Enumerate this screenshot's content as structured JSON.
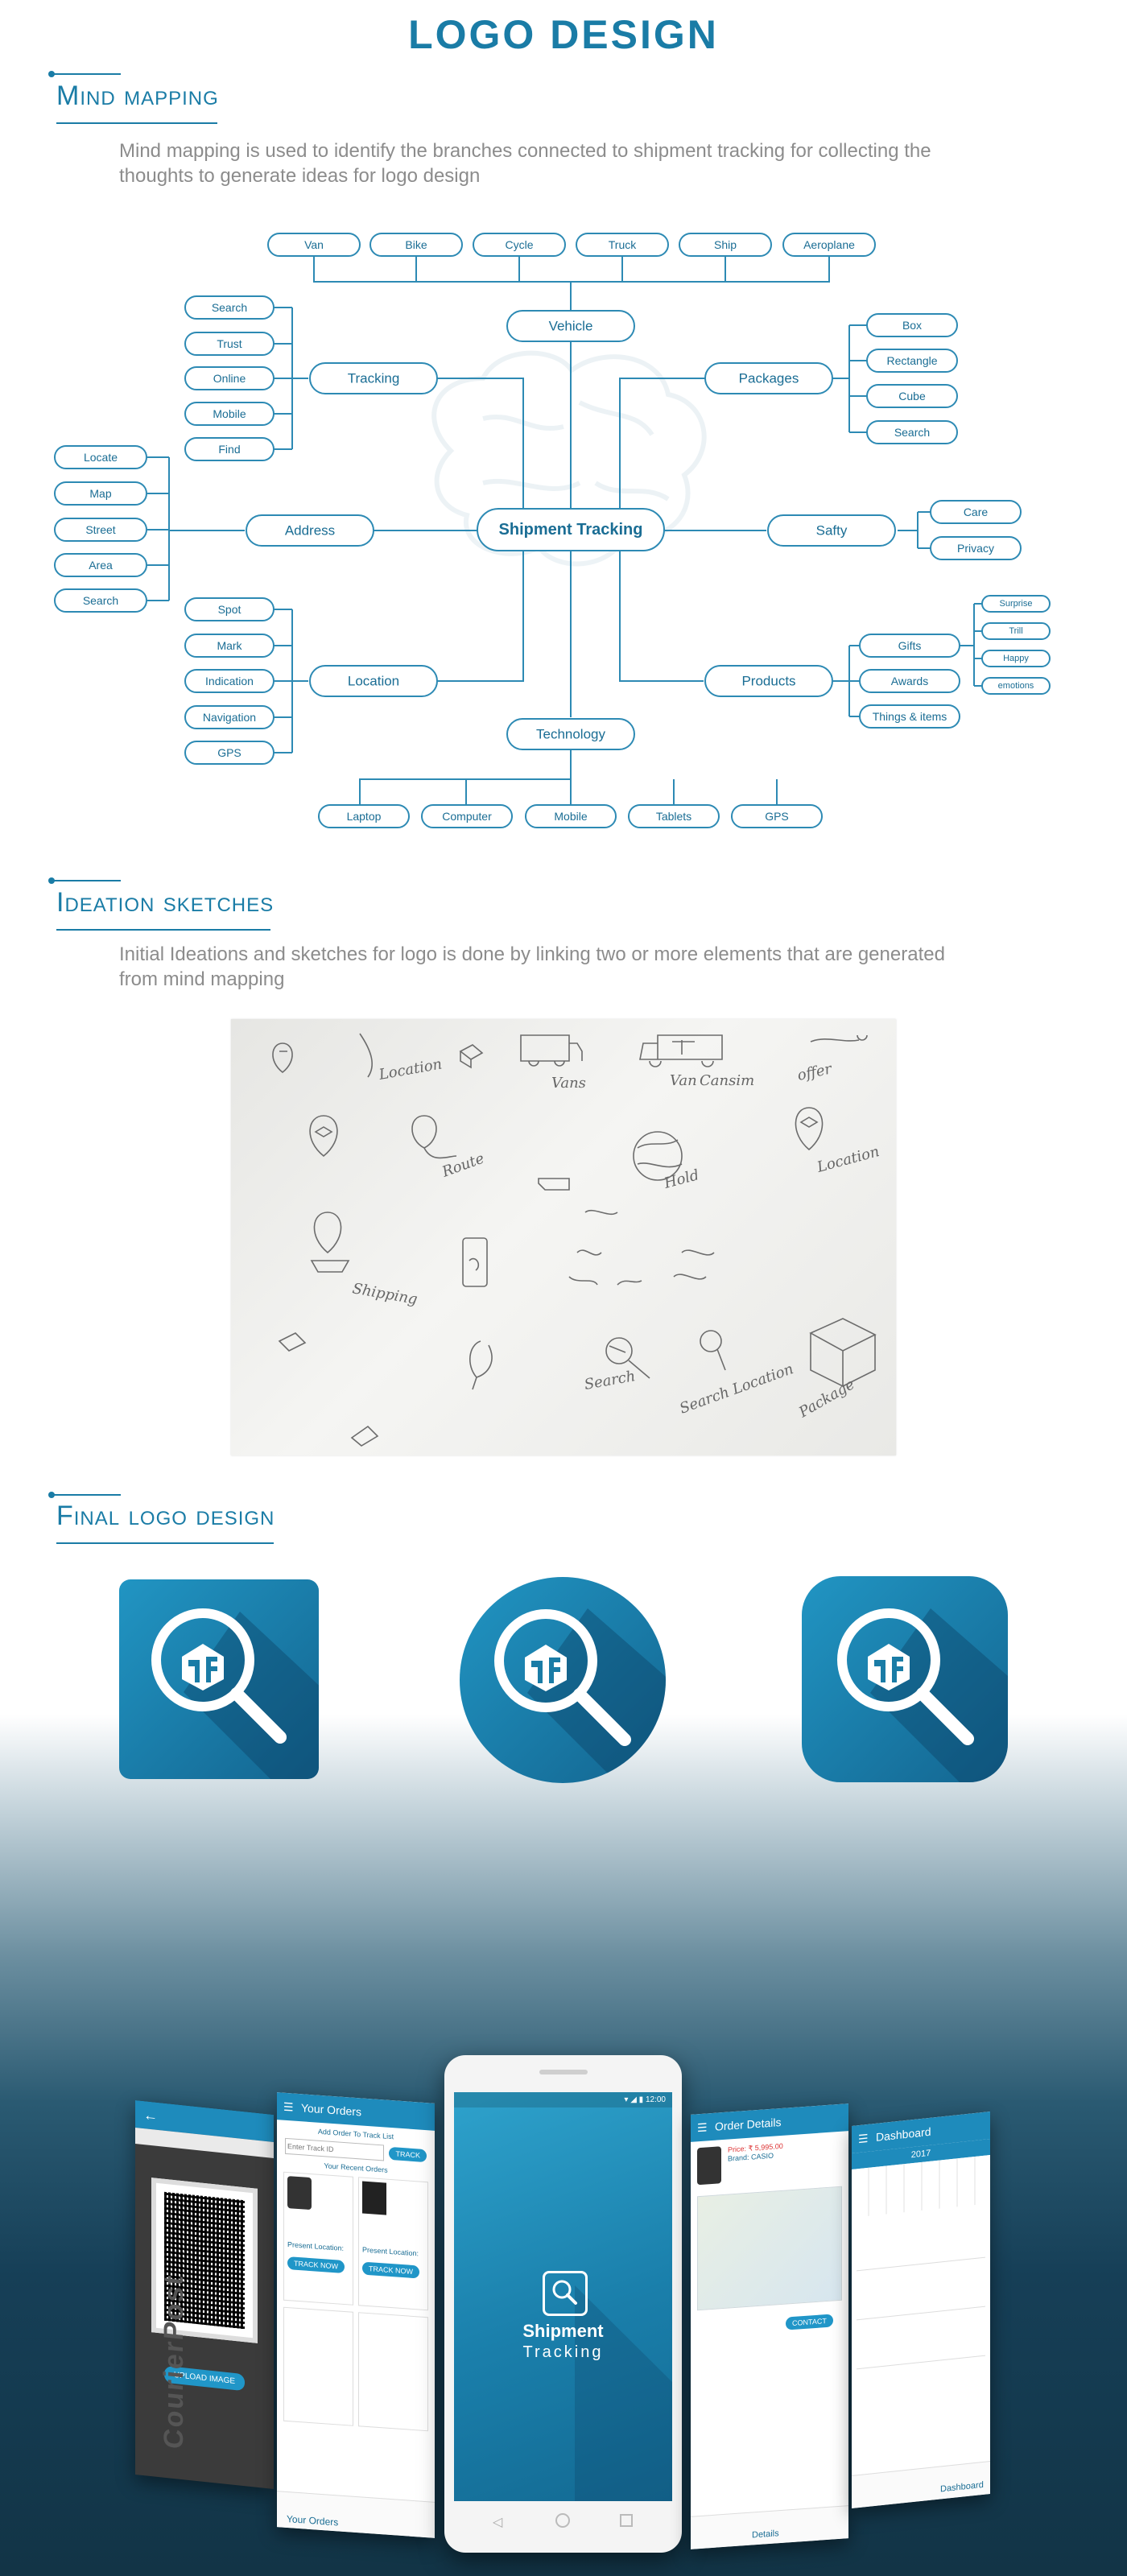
{
  "page_title": "LOGO DESIGN",
  "mind_mapping": {
    "heading": "Mind mapping",
    "description": "Mind mapping is used to identify the branches connected to shipment tracking for collecting the thoughts to generate ideas for logo design",
    "center": "Shipment Tracking",
    "vehicle": {
      "label": "Vehicle",
      "items": [
        "Van",
        "Bike",
        "Cycle",
        "Truck",
        "Ship",
        "Aeroplane"
      ]
    },
    "tracking": {
      "label": "Tracking",
      "items": [
        "Search",
        "Trust",
        "Online",
        "Mobile",
        "Find"
      ]
    },
    "packages": {
      "label": "Packages",
      "items": [
        "Box",
        "Rectangle",
        "Cube",
        "Search"
      ]
    },
    "address": {
      "label": "Address",
      "items": [
        "Locate",
        "Map",
        "Street",
        "Area",
        "Search"
      ]
    },
    "safty": {
      "label": "Safty",
      "items": [
        "Care",
        "Privacy"
      ]
    },
    "location": {
      "label": "Location",
      "items": [
        "Spot",
        "Mark",
        "Indication",
        "Navigation",
        "GPS"
      ]
    },
    "products": {
      "label": "Products",
      "items": [
        "Gifts",
        "Awards",
        "Things & items"
      ],
      "gift_items": [
        "Surprise",
        "Trill",
        "Happy",
        "emotions"
      ]
    },
    "technology": {
      "label": "Technology",
      "items": [
        "Laptop",
        "Computer",
        "Mobile",
        "Tablets",
        "GPS"
      ]
    }
  },
  "ideation": {
    "heading": "Ideation sketches",
    "description": "Initial Ideations and sketches for logo is done by linking two or more elements that are generated from mind mapping",
    "sketch_words": [
      "Location",
      "Vans",
      "Van",
      "Cansim",
      "offer",
      "Route",
      "Hold",
      "Location",
      "Shipping",
      "Search",
      "Search Location",
      "Package"
    ]
  },
  "final_logo": {
    "heading": "Final logo design"
  },
  "mockup": {
    "center_phone": {
      "time": "12:00",
      "app_name_line1": "Shipment",
      "app_name_line2": "Tracking"
    },
    "orders_phone": {
      "title": "Your Orders",
      "add_order": "Add Order To Track List",
      "input_placeholder": "Enter Track ID",
      "track_button": "TRACK",
      "recent": "Your Recent Orders",
      "track_now": "TRACK NOW",
      "nav_label": "Your Orders",
      "present_location": "Present Location:"
    },
    "details_phone": {
      "title": "Order Details",
      "price": "Price: ₹ 5,995.00",
      "brand": "Brand: CASIO",
      "contact": "CONTACT",
      "nav_label": "Details"
    },
    "dashboard_phone": {
      "title": "Dashboard",
      "year": "2017",
      "nav_label": "Dashboard"
    },
    "scan_phone": {
      "upload": "UPLOAD IMAGE",
      "brand": "CourierPost"
    }
  },
  "colors": {
    "primary": "#1a7ca6",
    "pill_stroke": "#2d8ab4",
    "logo_dark": "#156b97",
    "logo_light": "#1f8dbb"
  }
}
